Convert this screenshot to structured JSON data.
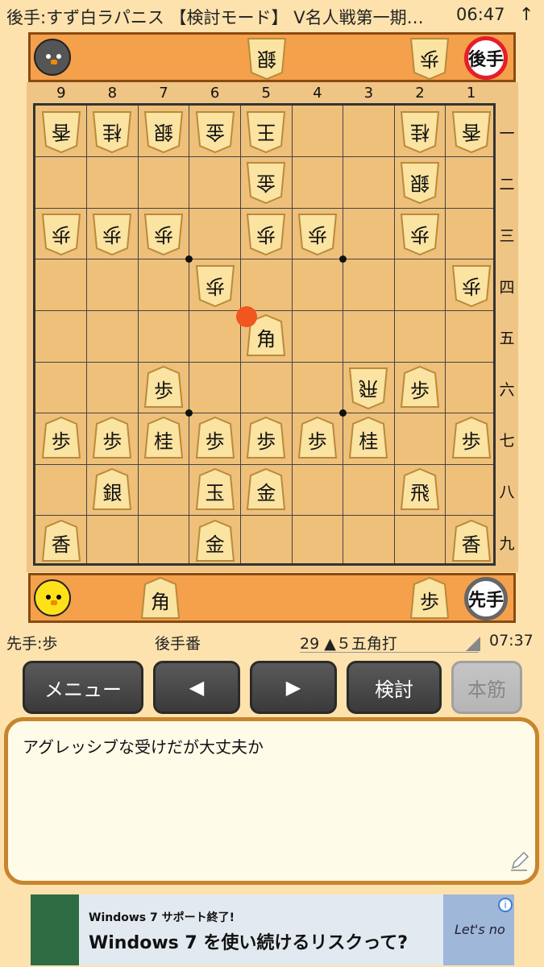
{
  "status_bar": {
    "title": "後手:すず白ラパニス 【検討モード】 V名人戦第一期…",
    "time": "06:47",
    "arrow": "↑"
  },
  "gote_hand": {
    "role": "後手",
    "pieces": [
      {
        "glyph": "銀"
      },
      {
        "glyph": "歩"
      }
    ]
  },
  "sente_hand": {
    "role": "先手",
    "pieces": [
      {
        "glyph": "角"
      },
      {
        "glyph": "歩"
      }
    ]
  },
  "board": {
    "files": [
      "9",
      "8",
      "7",
      "6",
      "5",
      "4",
      "3",
      "2",
      "1"
    ],
    "ranks": [
      "一",
      "二",
      "三",
      "四",
      "五",
      "六",
      "七",
      "八",
      "九"
    ],
    "pieces": [
      {
        "file": 9,
        "rank": 1,
        "glyph": "香",
        "side": "gote"
      },
      {
        "file": 8,
        "rank": 1,
        "glyph": "桂",
        "side": "gote"
      },
      {
        "file": 7,
        "rank": 1,
        "glyph": "銀",
        "side": "gote"
      },
      {
        "file": 6,
        "rank": 1,
        "glyph": "金",
        "side": "gote"
      },
      {
        "file": 5,
        "rank": 1,
        "glyph": "王",
        "side": "gote"
      },
      {
        "file": 2,
        "rank": 1,
        "glyph": "桂",
        "side": "gote"
      },
      {
        "file": 1,
        "rank": 1,
        "glyph": "香",
        "side": "gote"
      },
      {
        "file": 5,
        "rank": 2,
        "glyph": "金",
        "side": "gote"
      },
      {
        "file": 2,
        "rank": 2,
        "glyph": "銀",
        "side": "gote"
      },
      {
        "file": 9,
        "rank": 3,
        "glyph": "歩",
        "side": "gote"
      },
      {
        "file": 8,
        "rank": 3,
        "glyph": "歩",
        "side": "gote"
      },
      {
        "file": 7,
        "rank": 3,
        "glyph": "歩",
        "side": "gote"
      },
      {
        "file": 5,
        "rank": 3,
        "glyph": "歩",
        "side": "gote"
      },
      {
        "file": 4,
        "rank": 3,
        "glyph": "歩",
        "side": "gote"
      },
      {
        "file": 2,
        "rank": 3,
        "glyph": "歩",
        "side": "gote"
      },
      {
        "file": 6,
        "rank": 4,
        "glyph": "歩",
        "side": "gote"
      },
      {
        "file": 1,
        "rank": 4,
        "glyph": "歩",
        "side": "gote"
      },
      {
        "file": 5,
        "rank": 5,
        "glyph": "角",
        "side": "sente"
      },
      {
        "file": 7,
        "rank": 6,
        "glyph": "歩",
        "side": "sente"
      },
      {
        "file": 3,
        "rank": 6,
        "glyph": "飛",
        "side": "gote"
      },
      {
        "file": 2,
        "rank": 6,
        "glyph": "歩",
        "side": "sente"
      },
      {
        "file": 9,
        "rank": 7,
        "glyph": "歩",
        "side": "sente"
      },
      {
        "file": 8,
        "rank": 7,
        "glyph": "歩",
        "side": "sente"
      },
      {
        "file": 7,
        "rank": 7,
        "glyph": "桂",
        "side": "sente"
      },
      {
        "file": 6,
        "rank": 7,
        "glyph": "歩",
        "side": "sente"
      },
      {
        "file": 5,
        "rank": 7,
        "glyph": "歩",
        "side": "sente"
      },
      {
        "file": 4,
        "rank": 7,
        "glyph": "歩",
        "side": "sente"
      },
      {
        "file": 3,
        "rank": 7,
        "glyph": "桂",
        "side": "sente"
      },
      {
        "file": 1,
        "rank": 7,
        "glyph": "歩",
        "side": "sente"
      },
      {
        "file": 8,
        "rank": 8,
        "glyph": "銀",
        "side": "sente"
      },
      {
        "file": 6,
        "rank": 8,
        "glyph": "玉",
        "side": "sente"
      },
      {
        "file": 5,
        "rank": 8,
        "glyph": "金",
        "side": "sente"
      },
      {
        "file": 2,
        "rank": 8,
        "glyph": "飛",
        "side": "sente"
      },
      {
        "file": 9,
        "rank": 9,
        "glyph": "香",
        "side": "sente"
      },
      {
        "file": 6,
        "rank": 9,
        "glyph": "金",
        "side": "sente"
      },
      {
        "file": 1,
        "rank": 9,
        "glyph": "香",
        "side": "sente"
      }
    ],
    "last_move": {
      "file": 5,
      "rank": 5
    }
  },
  "info": {
    "sente_hand": "先手:歩",
    "turn": "後手番",
    "move": "29 ▲５五角打",
    "time": "07:37"
  },
  "buttons": {
    "menu": "メニュー",
    "prev": "◀",
    "next": "▶",
    "analyze": "検討",
    "mainline": "本筋"
  },
  "comment": "アグレッシブな受けだが大丈夫か",
  "ad": {
    "small": "Windows 7 サポート終了!",
    "big": "Windows 7 を使い続けるリスクって?",
    "brand": "Let's no",
    "info": "i"
  },
  "colors": {
    "background": "#fde2ad",
    "board": "#eec07a",
    "hand_bar": "#f5a04b",
    "gote_badge_ring": "#e41e2a",
    "last_move_dot": "#f0561e",
    "comment_border": "#c8852d",
    "button": "#4a4a4a"
  }
}
